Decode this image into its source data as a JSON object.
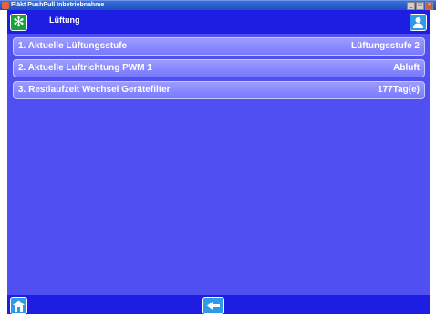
{
  "window": {
    "title": "Fläkt PushPull Inbetriebnahme"
  },
  "header": {
    "title": "Lüftung"
  },
  "rows": [
    {
      "label": "1. Aktuelle Lüftungsstufe",
      "value": "Lüftungsstufe 2"
    },
    {
      "label": "2. Aktuelle Luftrichtung PWM 1",
      "value": "Abluft"
    },
    {
      "label": "3. Restlaufzeit Wechsel Gerätefilter",
      "value": "177Tag(e)"
    }
  ],
  "icons": {
    "header_left": "fan-icon",
    "header_right": "user-icon",
    "footer_left": "home-icon",
    "footer_center": "back-arrow-icon"
  },
  "colors": {
    "background": "#5050f2",
    "header_bar": "#1e1ee2",
    "row": "#8c8cff",
    "fan_button": "#17a33c",
    "icon_button": "#2f9ae8"
  }
}
